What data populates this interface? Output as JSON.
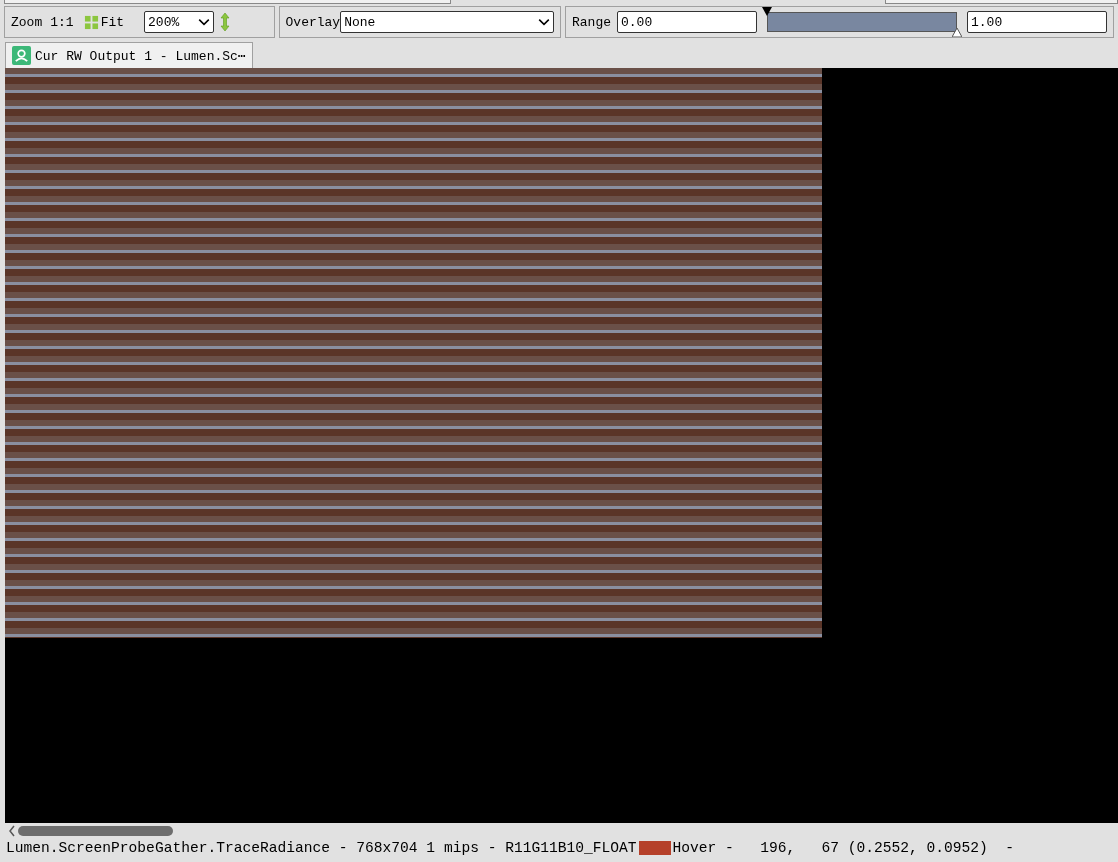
{
  "toolbar": {
    "zoom_label": "Zoom",
    "actual_size": "1:1",
    "fit": "Fit",
    "zoom_value": "200%",
    "overlay_label": "Overlay",
    "overlay_value": "None",
    "range_label": "Range",
    "range_min": "0.00",
    "range_max": "1.00",
    "range_slider": {
      "level": 1
    }
  },
  "tabs": [
    {
      "label": "Cur RW Output 1 - Lumen.Sc⋯",
      "selected": true
    }
  ],
  "status_bar": {
    "texture_info": "Lumen.ScreenProbeGather.TraceRadiance - 768x704 1 mips - R11G11B10_FLOAT",
    "hover_swatch": {
      "color": "#b5402a"
    },
    "hover_info": "Hover -   196,   67 (0.2552, 0.0952)  -"
  }
}
